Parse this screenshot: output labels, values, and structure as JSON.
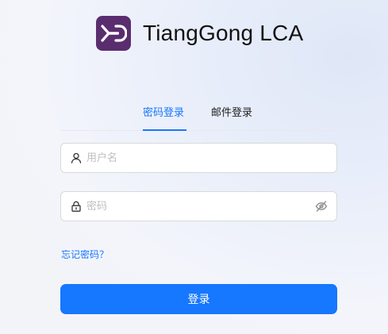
{
  "app": {
    "title": "TiangGong LCA"
  },
  "tabs": [
    {
      "label": "密码登录",
      "active": true
    },
    {
      "label": "邮件登录",
      "active": false
    }
  ],
  "form": {
    "username_placeholder": "用户名",
    "username_value": "",
    "password_placeholder": "密码",
    "password_value": "",
    "forgot_label": "忘记密码？",
    "submit_label": "登录"
  },
  "icons": {
    "logo": "tiangong-logo-icon",
    "username_prefix": "user-icon",
    "password_prefix": "lock-icon",
    "password_toggle": "eye-invisible-icon"
  },
  "colors": {
    "accent": "#1677ff",
    "logo_bg": "#5a2d6e"
  }
}
